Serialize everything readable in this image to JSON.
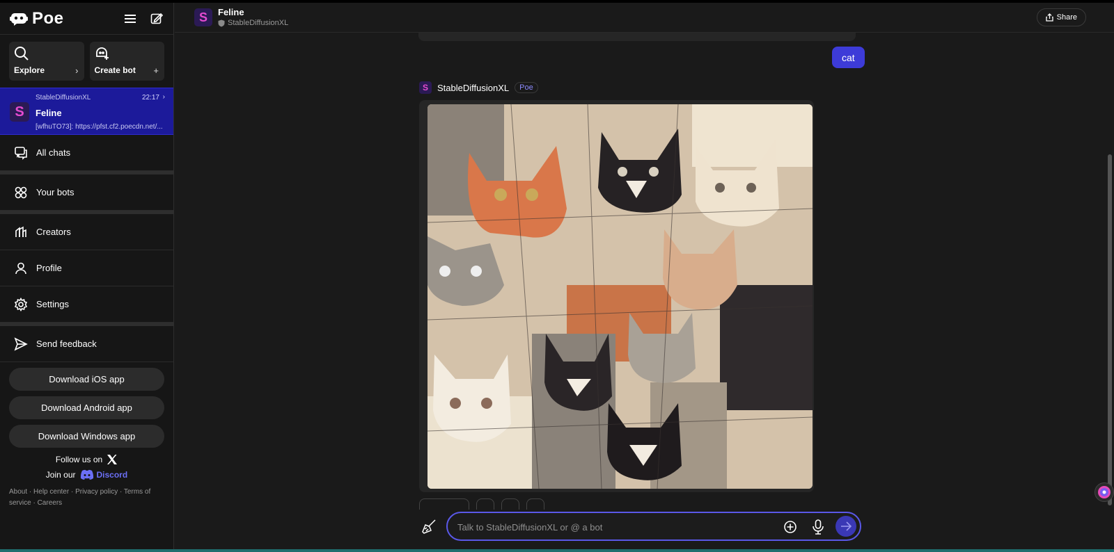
{
  "app": {
    "name": "Poe"
  },
  "quick_actions": {
    "explore": {
      "label": "Explore"
    },
    "create_bot": {
      "label": "Create bot"
    }
  },
  "active_chat": {
    "bot": "StableDiffusionXL",
    "time": "22:17",
    "title": "Feline",
    "preview": "[wfhuTO73]: https://pfst.cf2.poecdn.net/..."
  },
  "nav": {
    "all_chats": "All chats",
    "your_bots": "Your bots",
    "creators": "Creators",
    "profile": "Profile",
    "settings": "Settings",
    "send_feedback": "Send feedback"
  },
  "downloads": {
    "ios": "Download iOS app",
    "android": "Download Android app",
    "windows": "Download Windows app"
  },
  "social": {
    "follow": "Follow us on",
    "join": "Join our",
    "discord": "Discord"
  },
  "footer": {
    "about": "About",
    "help": "Help center",
    "privacy": "Privacy policy",
    "terms": "Terms of service",
    "careers": "Careers"
  },
  "header": {
    "title": "Feline",
    "subtitle": "StableDiffusionXL",
    "share": "Share"
  },
  "conversation": {
    "user_message": "cat",
    "bot_name": "StableDiffusionXL",
    "bot_badge": "Poe"
  },
  "composer": {
    "placeholder": "Talk to StableDiffusionXL or @ a bot"
  },
  "colors": {
    "accent": "#3d3bd8",
    "active_chat_bg": "#1c1a9a",
    "discord": "#6b6ff5"
  }
}
